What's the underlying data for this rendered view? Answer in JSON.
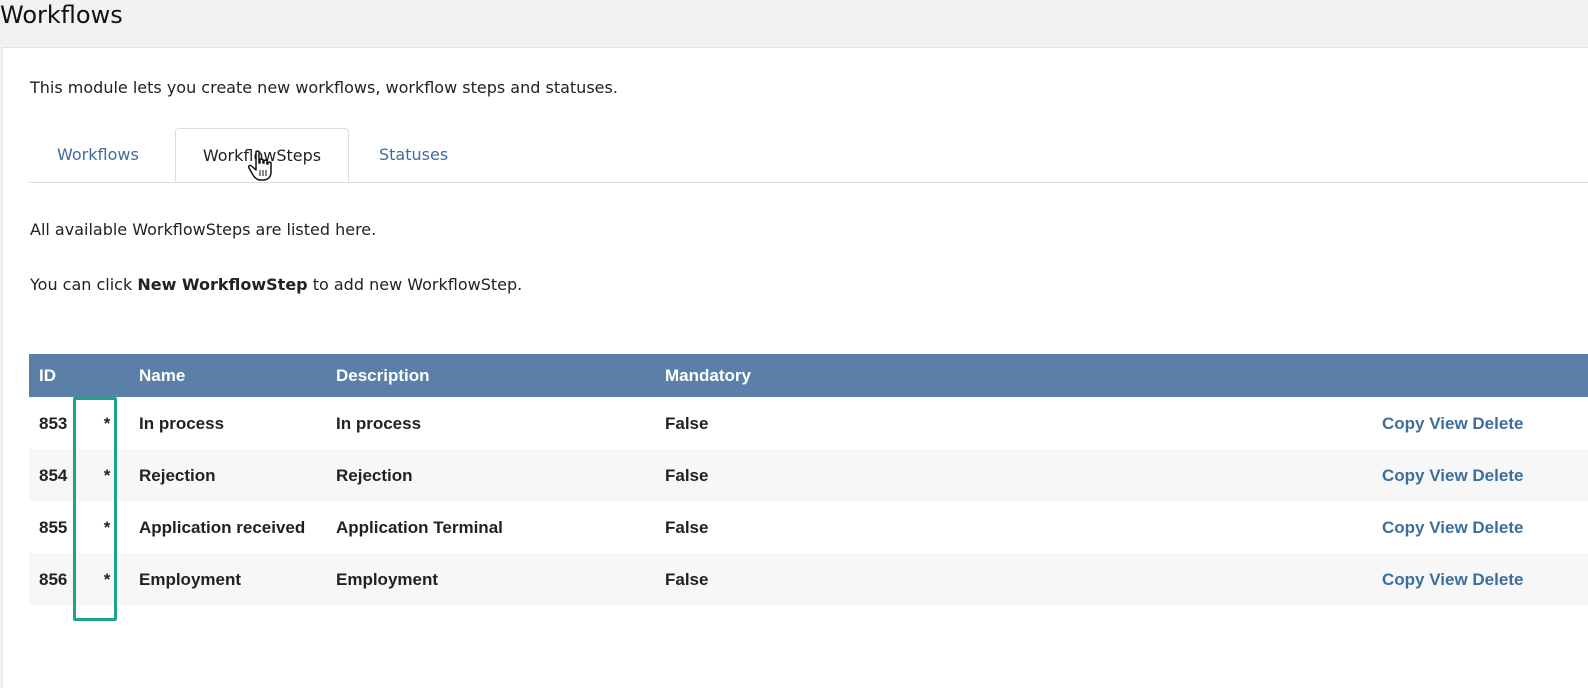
{
  "page": {
    "title": "Workflows"
  },
  "intro": "This module lets you create new workflows, workflow steps and statuses.",
  "tabs": [
    {
      "label": "Workflows",
      "active": false
    },
    {
      "label": "WorkflowSteps",
      "active": true
    },
    {
      "label": "Statuses",
      "active": false
    }
  ],
  "info": {
    "line1": "All available WorkflowSteps are listed here.",
    "line2_prefix": "You can click ",
    "line2_bold": "New WorkflowStep",
    "line2_suffix": " to add new WorkflowStep."
  },
  "table": {
    "headers": {
      "id": "ID",
      "star": "",
      "name": "Name",
      "description": "Description",
      "mandatory": "Mandatory",
      "actions": ""
    },
    "rows": [
      {
        "id": "853",
        "star": "*",
        "name": "In process",
        "description": "In process",
        "mandatory": "False"
      },
      {
        "id": "854",
        "star": "*",
        "name": "Rejection",
        "description": "Rejection",
        "mandatory": "False"
      },
      {
        "id": "855",
        "star": "*",
        "name": "Application received",
        "description": "Application Terminal",
        "mandatory": "False"
      },
      {
        "id": "856",
        "star": "*",
        "name": "Employment",
        "description": "Employment",
        "mandatory": "False"
      }
    ],
    "actions": {
      "copy": "Copy",
      "view": "View",
      "delete": "Delete"
    }
  },
  "colors": {
    "header_bg": "#5a80a8",
    "link": "#3c6e9e",
    "highlight": "#1aa58a"
  },
  "icons": {
    "cursor": "hand-pointer-icon"
  }
}
